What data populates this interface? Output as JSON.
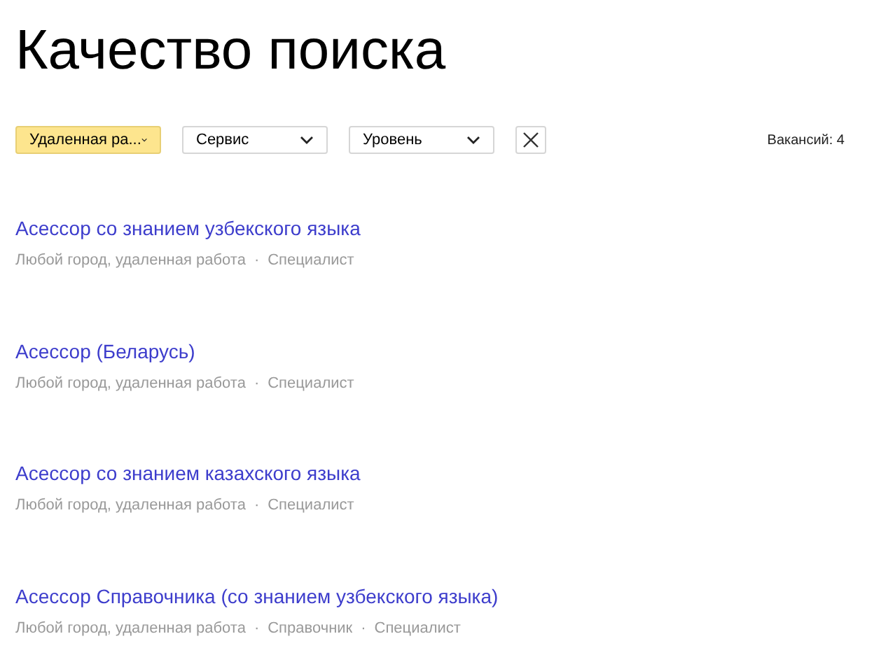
{
  "title": "Качество поиска",
  "filters": [
    {
      "label": "Удаленная ра...",
      "active": true
    },
    {
      "label": "Сервис",
      "active": false
    },
    {
      "label": "Уровень",
      "active": false
    }
  ],
  "count": "Вакансий: 4",
  "separator": "·",
  "vacancies": [
    {
      "title": "Асессор со знанием узбекского языка",
      "meta": [
        "Любой город, удаленная работа",
        "Специалист"
      ]
    },
    {
      "title": "Асессор (Беларусь)",
      "meta": [
        "Любой город, удаленная работа",
        "Специалист"
      ]
    },
    {
      "title": "Асессор со знанием казахского языка",
      "meta": [
        "Любой город, удаленная работа",
        "Специалист"
      ]
    },
    {
      "title": "Асессор Справочника (со знанием узбекского языка)",
      "meta": [
        "Любой город, удаленная работа",
        "Справочник",
        "Специалист"
      ]
    }
  ]
}
